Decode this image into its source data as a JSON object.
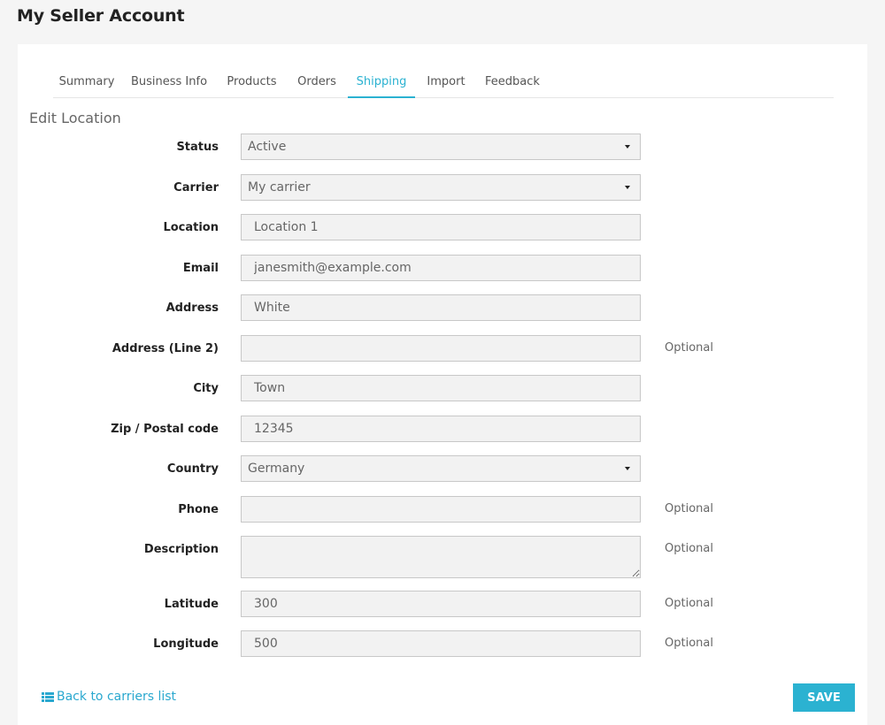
{
  "page": {
    "title": "My Seller Account"
  },
  "tabs": [
    {
      "label": "Summary"
    },
    {
      "label": "Business Info"
    },
    {
      "label": "Products"
    },
    {
      "label": "Orders"
    },
    {
      "label": "Shipping",
      "active": true
    },
    {
      "label": "Import"
    },
    {
      "label": "Feedback"
    }
  ],
  "form": {
    "title": "Edit Location",
    "status": {
      "label": "Status",
      "value": "Active"
    },
    "carrier": {
      "label": "Carrier",
      "value": "My carrier"
    },
    "location": {
      "label": "Location",
      "value": "Location 1"
    },
    "email": {
      "label": "Email",
      "value": "janesmith@example.com"
    },
    "address": {
      "label": "Address",
      "value": "White"
    },
    "address2": {
      "label": "Address (Line 2)",
      "value": "",
      "hint": "Optional"
    },
    "city": {
      "label": "City",
      "value": "Town"
    },
    "zip": {
      "label": "Zip / Postal code",
      "value": "12345"
    },
    "country": {
      "label": "Country",
      "value": "Germany"
    },
    "phone": {
      "label": "Phone",
      "value": "",
      "hint": "Optional"
    },
    "description": {
      "label": "Description",
      "value": "",
      "hint": "Optional"
    },
    "latitude": {
      "label": "Latitude",
      "value": "300",
      "hint": "Optional"
    },
    "longitude": {
      "label": "Longitude",
      "value": "500",
      "hint": "Optional"
    }
  },
  "footer": {
    "back_label": "Back to carriers list",
    "back_icon": "list-icon",
    "save_label": "SAVE"
  },
  "colors": {
    "accent": "#2bb2d1",
    "link": "#2aa8cf",
    "field_bg": "#f2f2f2",
    "field_border": "#c8c8c8"
  }
}
